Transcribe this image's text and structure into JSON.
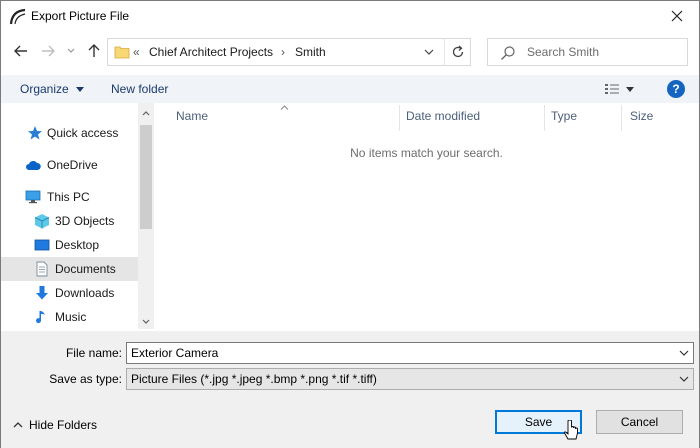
{
  "window": {
    "title": "Export Picture File",
    "close_glyph": "✕"
  },
  "address": {
    "overflow": "«",
    "crumbs": [
      "Chief Architect Projects",
      "Smith"
    ],
    "separator": "›"
  },
  "search": {
    "placeholder": "Search Smith"
  },
  "toolbar": {
    "organize": "Organize",
    "new_folder": "New folder",
    "help": "?"
  },
  "nav": {
    "items": [
      {
        "label": "Quick access",
        "icon": "star-icon"
      },
      {
        "label": "OneDrive",
        "icon": "cloud-icon"
      },
      {
        "label": "This PC",
        "icon": "computer-icon"
      },
      {
        "label": "3D Objects",
        "icon": "cube-icon"
      },
      {
        "label": "Desktop",
        "icon": "desktop-icon"
      },
      {
        "label": "Documents",
        "icon": "document-icon",
        "selected": true
      },
      {
        "label": "Downloads",
        "icon": "download-arrow-icon"
      },
      {
        "label": "Music",
        "icon": "music-note-icon"
      }
    ]
  },
  "list": {
    "columns": [
      "Name",
      "Date modified",
      "Type",
      "Size"
    ],
    "empty_message": "No items match your search."
  },
  "form": {
    "file_name_label": "File name:",
    "file_name_value": "Exterior Camera",
    "save_type_label": "Save as type:",
    "save_type_value": "Picture Files (*.jpg *.jpeg *.bmp *.png *.tif *.tiff)"
  },
  "footer": {
    "hide_folders": "Hide Folders",
    "save": "Save",
    "cancel": "Cancel"
  },
  "colors": {
    "accent": "#0078d7",
    "link": "#1a3a6b",
    "folder": "#f8d775",
    "selected_bg": "#e5e5e5"
  }
}
